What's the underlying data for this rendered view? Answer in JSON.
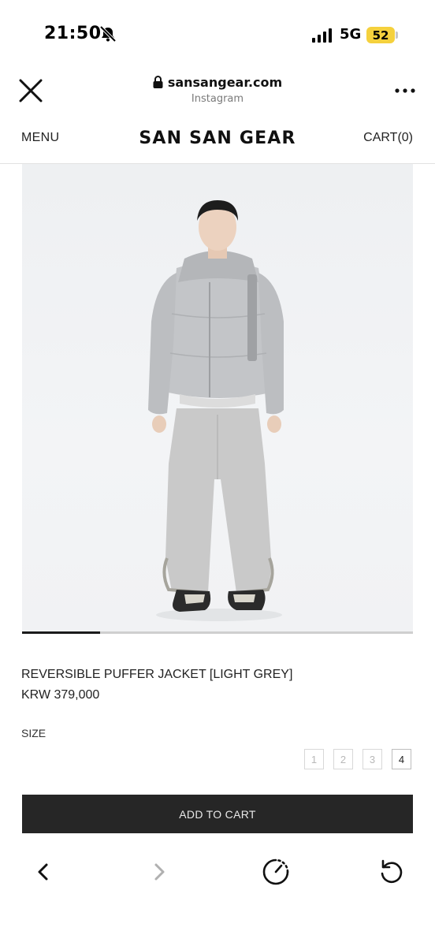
{
  "status_bar": {
    "time": "21:50",
    "network": "5G",
    "battery": "52",
    "icons": [
      "bell-slash-icon",
      "signal-bars-icon"
    ]
  },
  "browser": {
    "domain": "sansangear.com",
    "source": "Instagram",
    "icons": [
      "close-icon",
      "lock-icon",
      "more-icon"
    ]
  },
  "site_header": {
    "menu_label": "MENU",
    "logo": "SAN SAN GEAR",
    "cart_label": "CART(0)"
  },
  "gallery": {
    "current_slide": 1,
    "total_slides": 5,
    "progress": 0.2
  },
  "product": {
    "name": "REVERSIBLE PUFFER JACKET [LIGHT GREY]",
    "price": "KRW 379,000",
    "size_label": "SIZE",
    "sizes": [
      {
        "label": "1",
        "available": false
      },
      {
        "label": "2",
        "available": false
      },
      {
        "label": "3",
        "available": false
      },
      {
        "label": "4",
        "available": true
      }
    ],
    "add_to_cart_label": "ADD TO CART"
  },
  "toolbar": {
    "icons": [
      "back-icon",
      "forward-icon",
      "compass-icon",
      "reload-icon"
    ]
  },
  "colors": {
    "button_bg": "#262626",
    "battery": "#f5d13d",
    "progress_fill": "#1b1b1b"
  }
}
